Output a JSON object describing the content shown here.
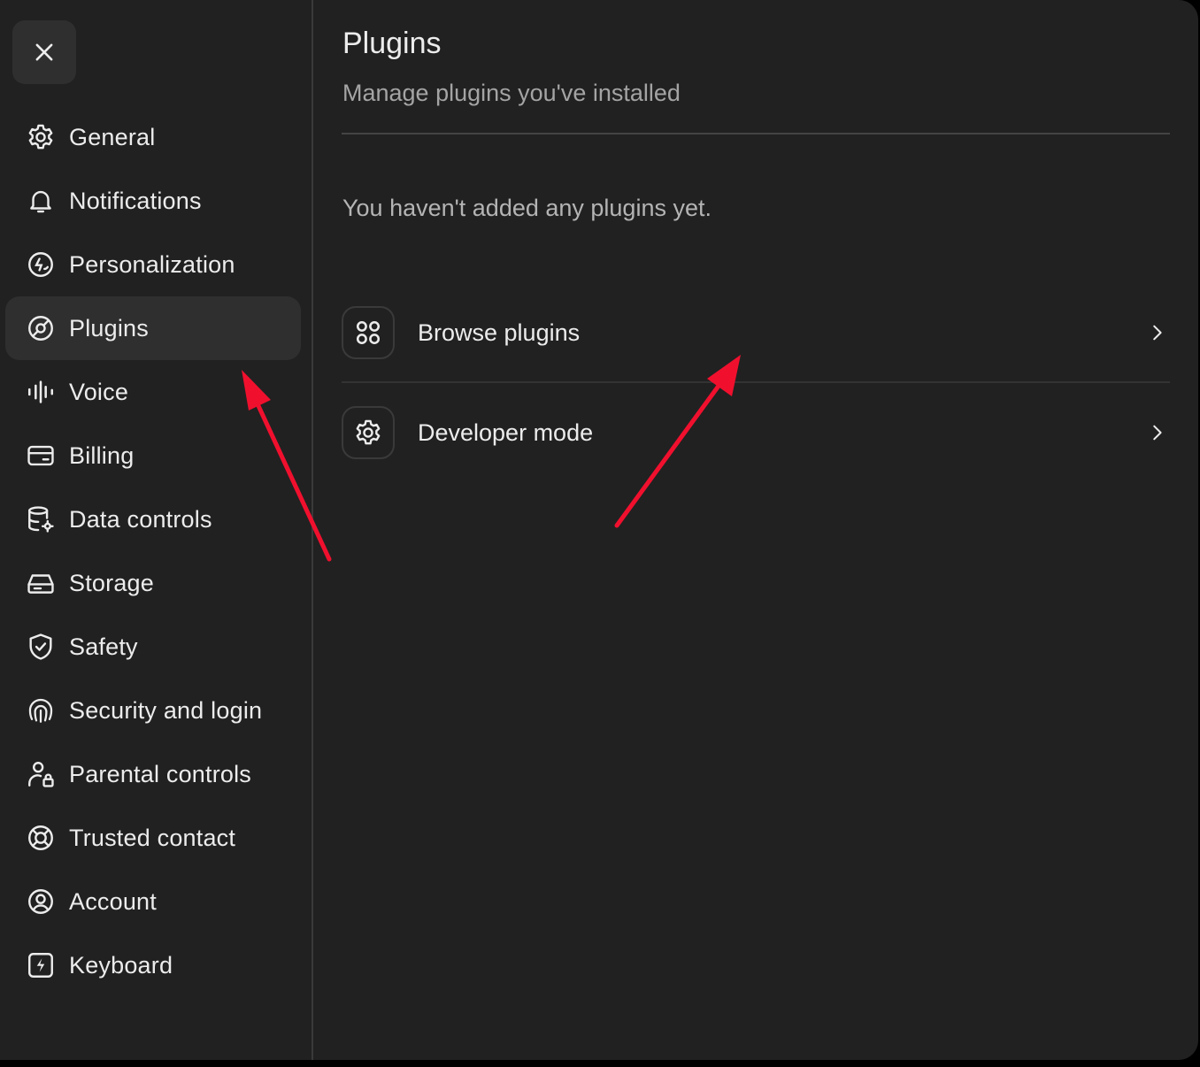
{
  "sidebar": {
    "close_icon": "close-icon",
    "items": [
      {
        "label": "General",
        "icon": "gear-icon"
      },
      {
        "label": "Notifications",
        "icon": "bell-icon"
      },
      {
        "label": "Personalization",
        "icon": "personalization-icon"
      },
      {
        "label": "Plugins",
        "icon": "plugins-icon",
        "active": true
      },
      {
        "label": "Voice",
        "icon": "voice-waveform-icon"
      },
      {
        "label": "Billing",
        "icon": "credit-card-icon"
      },
      {
        "label": "Data controls",
        "icon": "database-gear-icon"
      },
      {
        "label": "Storage",
        "icon": "storage-drive-icon"
      },
      {
        "label": "Safety",
        "icon": "shield-check-icon"
      },
      {
        "label": "Security and login",
        "icon": "security-fingerprint-icon"
      },
      {
        "label": "Parental controls",
        "icon": "person-lock-icon"
      },
      {
        "label": "Trusted contact",
        "icon": "lifebuoy-icon"
      },
      {
        "label": "Account",
        "icon": "user-circle-icon"
      },
      {
        "label": "Keyboard",
        "icon": "keyboard-bolt-icon"
      }
    ]
  },
  "main": {
    "title": "Plugins",
    "subtitle": "Manage plugins you've installed",
    "empty_message": "You haven't added any plugins yet.",
    "rows": [
      {
        "label": "Browse plugins",
        "icon": "apps-grid-icon",
        "chevron": "chevron-right-icon"
      },
      {
        "label": "Developer mode",
        "icon": "gear-icon",
        "chevron": "chevron-right-icon"
      }
    ]
  },
  "colors": {
    "background": "#212121",
    "sidebar_active": "#2f2f2f",
    "text_primary": "#ececec",
    "text_secondary": "#a4a4a4",
    "annotation_arrow": "#f0102e"
  }
}
